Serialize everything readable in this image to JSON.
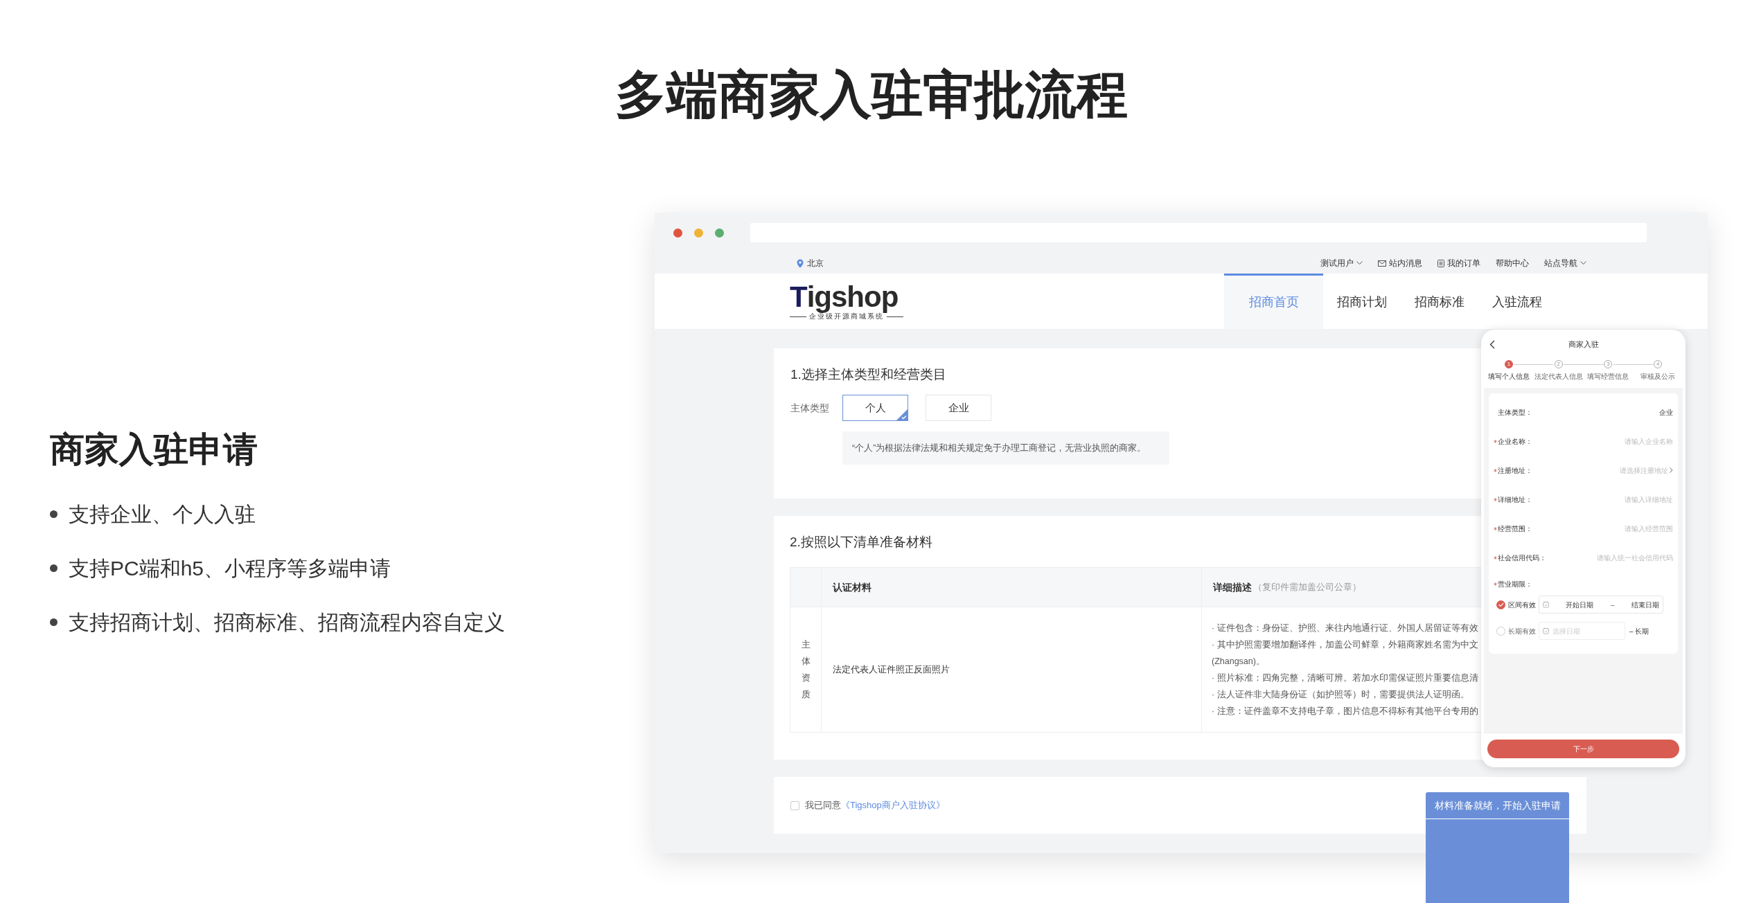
{
  "page_title": "多端商家入驻审批流程",
  "feature": {
    "heading": "商家入驻申请",
    "bullets": [
      "支持企业、个人入驻",
      "支持PC端和h5、小程序等多端申请",
      "支持招商计划、招商标准、招商流程内容自定义"
    ]
  },
  "browser": {
    "topbar": {
      "location": "北京",
      "links": [
        {
          "label": "测试用户",
          "kind": "dropdown"
        },
        {
          "label": "站内消息",
          "kind": "mail"
        },
        {
          "label": "我的订单",
          "kind": "order"
        },
        {
          "label": "帮助中心",
          "kind": "plain"
        },
        {
          "label": "站点导航",
          "kind": "dropdown"
        }
      ]
    },
    "logo": {
      "initial": "T",
      "rest": "igshop",
      "tagline": "企业级开源商城系统"
    },
    "nav_tabs": [
      {
        "label": "招商首页",
        "selected": true
      },
      {
        "label": "招商计划",
        "selected": false
      },
      {
        "label": "招商标准",
        "selected": false
      },
      {
        "label": "入驻流程",
        "selected": false
      }
    ],
    "section1": {
      "title": "1.选择主体类型和经营类目",
      "field_label": "主体类型",
      "options": [
        {
          "label": "个人",
          "selected": true
        },
        {
          "label": "企业",
          "selected": false
        }
      ],
      "note": "“个人”为根据法律法规和相关规定免于办理工商登记，无营业执照的商家。"
    },
    "section2": {
      "title": "2.按照以下清单准备材料",
      "columns": [
        {
          "label": "认证材料"
        },
        {
          "label": "详细描述",
          "hint": "（复印件需加盖公司公章）"
        }
      ],
      "rows": [
        {
          "group": "主体资质",
          "material": "法定代表人证件照正反面照片",
          "details": [
            "· 证件包含：身份证、护照、来往内地通行证、外国人居留证等有效",
            "· 其中护照需要增加翻译件，加盖公司鲜章，外籍商家姓名需为中文",
            "(Zhangsan)。",
            "· 照片标准：四角完整，清晰可辨。若加水印需保证照片重要信息清",
            "· 法人证件非大陆身份证（如护照等）时，需要提供法人证明函。",
            "· 注意：证件盖章不支持电子章，图片信息不得标有其他平台专用的"
          ]
        }
      ]
    },
    "agreement": {
      "checked": false,
      "text": "我已同意",
      "link": "《Tigshop商户入驻协议》"
    },
    "submit_button": "材料准备就绪，开始入驻申请"
  },
  "mobile": {
    "title": "商家入驻",
    "steps": [
      {
        "number": "1",
        "label": "填写个人信息",
        "selected": true
      },
      {
        "number": "2",
        "label": "法定代表人信息",
        "selected": false
      },
      {
        "number": "3",
        "label": "填写经营信息",
        "selected": false
      },
      {
        "number": "4",
        "label": "审核及公示",
        "selected": false
      }
    ],
    "fields": [
      {
        "label": "主体类型：",
        "required": false,
        "value": "企业"
      },
      {
        "label": "企业名称：",
        "required": true,
        "placeholder": "请输入企业名称"
      },
      {
        "label": "注册地址：",
        "required": true,
        "placeholder": "请选择注册地址",
        "chevron": true
      },
      {
        "label": "详细地址：",
        "required": true,
        "placeholder": "请输入详细地址"
      },
      {
        "label": "经营范围：",
        "required": true,
        "placeholder": "请输入经营范围"
      },
      {
        "label": "社会信用代码：",
        "required": true,
        "placeholder": "请输入统一社会信用代码"
      }
    ],
    "period": {
      "label": "营业期限：",
      "required": true,
      "options": [
        {
          "kind": "range",
          "label": "区间有效",
          "selected": true,
          "start": "开始日期",
          "separator": "–",
          "end": "结束日期"
        },
        {
          "kind": "single",
          "label": "长期有效",
          "selected": false,
          "placeholder": "选择日期",
          "suffix": "– 长期"
        }
      ]
    },
    "next_button": "下一步"
  }
}
